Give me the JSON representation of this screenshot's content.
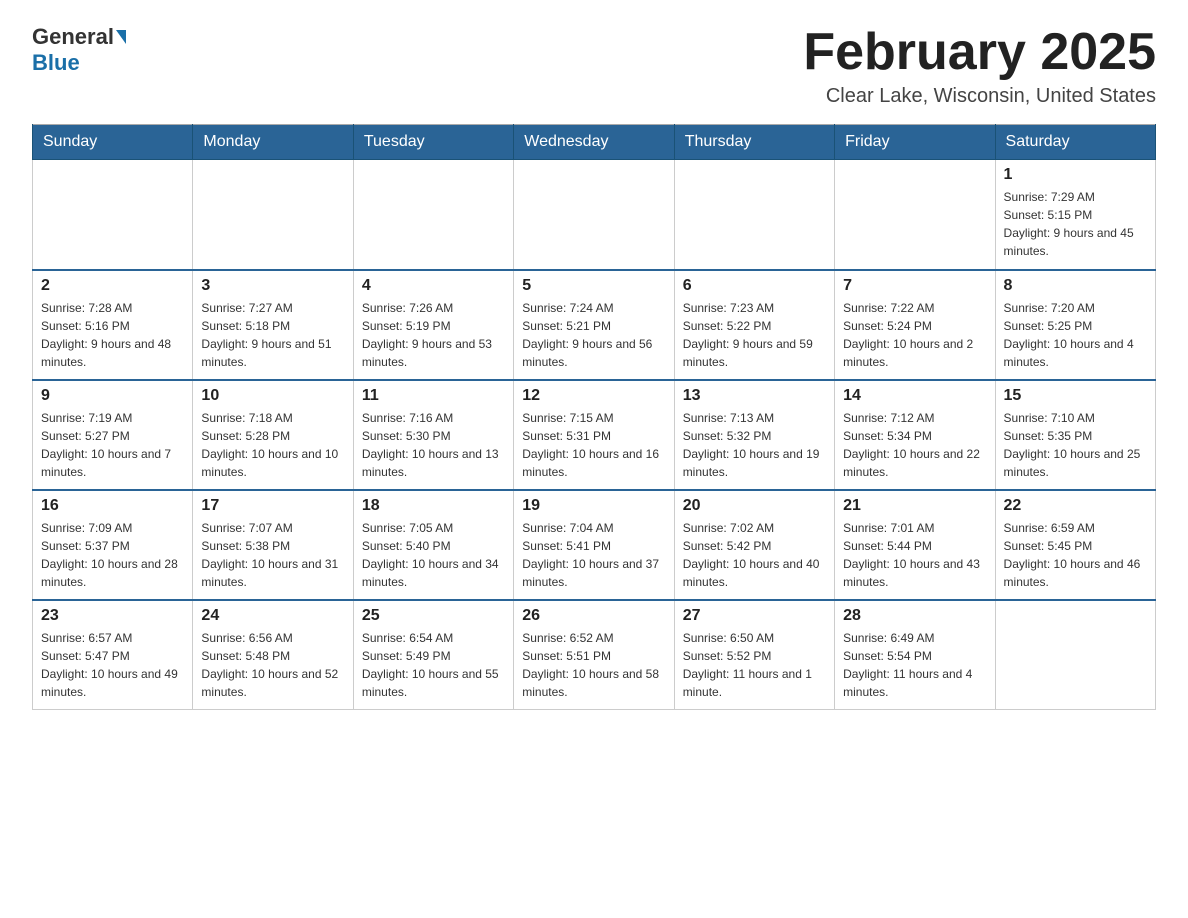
{
  "header": {
    "logo_general": "General",
    "logo_blue": "Blue",
    "month_title": "February 2025",
    "location": "Clear Lake, Wisconsin, United States"
  },
  "weekdays": [
    "Sunday",
    "Monday",
    "Tuesday",
    "Wednesday",
    "Thursday",
    "Friday",
    "Saturday"
  ],
  "weeks": [
    [
      {
        "day": "",
        "info": ""
      },
      {
        "day": "",
        "info": ""
      },
      {
        "day": "",
        "info": ""
      },
      {
        "day": "",
        "info": ""
      },
      {
        "day": "",
        "info": ""
      },
      {
        "day": "",
        "info": ""
      },
      {
        "day": "1",
        "info": "Sunrise: 7:29 AM\nSunset: 5:15 PM\nDaylight: 9 hours and 45 minutes."
      }
    ],
    [
      {
        "day": "2",
        "info": "Sunrise: 7:28 AM\nSunset: 5:16 PM\nDaylight: 9 hours and 48 minutes."
      },
      {
        "day": "3",
        "info": "Sunrise: 7:27 AM\nSunset: 5:18 PM\nDaylight: 9 hours and 51 minutes."
      },
      {
        "day": "4",
        "info": "Sunrise: 7:26 AM\nSunset: 5:19 PM\nDaylight: 9 hours and 53 minutes."
      },
      {
        "day": "5",
        "info": "Sunrise: 7:24 AM\nSunset: 5:21 PM\nDaylight: 9 hours and 56 minutes."
      },
      {
        "day": "6",
        "info": "Sunrise: 7:23 AM\nSunset: 5:22 PM\nDaylight: 9 hours and 59 minutes."
      },
      {
        "day": "7",
        "info": "Sunrise: 7:22 AM\nSunset: 5:24 PM\nDaylight: 10 hours and 2 minutes."
      },
      {
        "day": "8",
        "info": "Sunrise: 7:20 AM\nSunset: 5:25 PM\nDaylight: 10 hours and 4 minutes."
      }
    ],
    [
      {
        "day": "9",
        "info": "Sunrise: 7:19 AM\nSunset: 5:27 PM\nDaylight: 10 hours and 7 minutes."
      },
      {
        "day": "10",
        "info": "Sunrise: 7:18 AM\nSunset: 5:28 PM\nDaylight: 10 hours and 10 minutes."
      },
      {
        "day": "11",
        "info": "Sunrise: 7:16 AM\nSunset: 5:30 PM\nDaylight: 10 hours and 13 minutes."
      },
      {
        "day": "12",
        "info": "Sunrise: 7:15 AM\nSunset: 5:31 PM\nDaylight: 10 hours and 16 minutes."
      },
      {
        "day": "13",
        "info": "Sunrise: 7:13 AM\nSunset: 5:32 PM\nDaylight: 10 hours and 19 minutes."
      },
      {
        "day": "14",
        "info": "Sunrise: 7:12 AM\nSunset: 5:34 PM\nDaylight: 10 hours and 22 minutes."
      },
      {
        "day": "15",
        "info": "Sunrise: 7:10 AM\nSunset: 5:35 PM\nDaylight: 10 hours and 25 minutes."
      }
    ],
    [
      {
        "day": "16",
        "info": "Sunrise: 7:09 AM\nSunset: 5:37 PM\nDaylight: 10 hours and 28 minutes."
      },
      {
        "day": "17",
        "info": "Sunrise: 7:07 AM\nSunset: 5:38 PM\nDaylight: 10 hours and 31 minutes."
      },
      {
        "day": "18",
        "info": "Sunrise: 7:05 AM\nSunset: 5:40 PM\nDaylight: 10 hours and 34 minutes."
      },
      {
        "day": "19",
        "info": "Sunrise: 7:04 AM\nSunset: 5:41 PM\nDaylight: 10 hours and 37 minutes."
      },
      {
        "day": "20",
        "info": "Sunrise: 7:02 AM\nSunset: 5:42 PM\nDaylight: 10 hours and 40 minutes."
      },
      {
        "day": "21",
        "info": "Sunrise: 7:01 AM\nSunset: 5:44 PM\nDaylight: 10 hours and 43 minutes."
      },
      {
        "day": "22",
        "info": "Sunrise: 6:59 AM\nSunset: 5:45 PM\nDaylight: 10 hours and 46 minutes."
      }
    ],
    [
      {
        "day": "23",
        "info": "Sunrise: 6:57 AM\nSunset: 5:47 PM\nDaylight: 10 hours and 49 minutes."
      },
      {
        "day": "24",
        "info": "Sunrise: 6:56 AM\nSunset: 5:48 PM\nDaylight: 10 hours and 52 minutes."
      },
      {
        "day": "25",
        "info": "Sunrise: 6:54 AM\nSunset: 5:49 PM\nDaylight: 10 hours and 55 minutes."
      },
      {
        "day": "26",
        "info": "Sunrise: 6:52 AM\nSunset: 5:51 PM\nDaylight: 10 hours and 58 minutes."
      },
      {
        "day": "27",
        "info": "Sunrise: 6:50 AM\nSunset: 5:52 PM\nDaylight: 11 hours and 1 minute."
      },
      {
        "day": "28",
        "info": "Sunrise: 6:49 AM\nSunset: 5:54 PM\nDaylight: 11 hours and 4 minutes."
      },
      {
        "day": "",
        "info": ""
      }
    ]
  ]
}
